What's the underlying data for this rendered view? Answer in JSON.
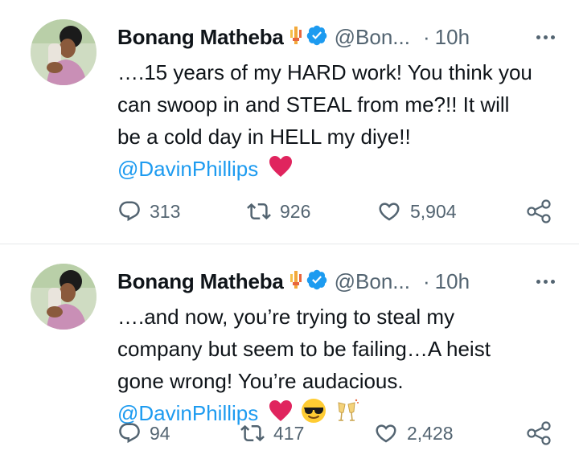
{
  "tweets": [
    {
      "author_name": "Bonang Matheba",
      "handle": "@Bon...",
      "separator": "·",
      "time": "10h",
      "lines": [
        "….15 years of my HARD work! You think you",
        "can swoop in and STEAL from me?!! It will",
        "be a cold day in HELL my diye!!"
      ],
      "mention": "@DavinPhillips",
      "emojis": [
        "red-heart"
      ],
      "replies": "313",
      "retweets": "926",
      "likes": "5,904"
    },
    {
      "author_name": "Bonang Matheba",
      "handle": "@Bon...",
      "separator": "·",
      "time": "10h",
      "lines": [
        "….and now, you’re trying to steal my",
        "company but seem to be failing…A heist",
        "gone wrong! You’re audacious."
      ],
      "mention": "@DavinPhillips",
      "emojis": [
        "red-heart",
        "sunglasses-face",
        "champagne-glasses"
      ],
      "replies": "94",
      "retweets": "417",
      "likes": "2,428"
    }
  ],
  "colors": {
    "text": "#0f1419",
    "secondary": "#536471",
    "link": "#1d9bf0",
    "verified": "#1d9bf0",
    "heart": "#e0245e",
    "divider": "#e7e9ea"
  }
}
